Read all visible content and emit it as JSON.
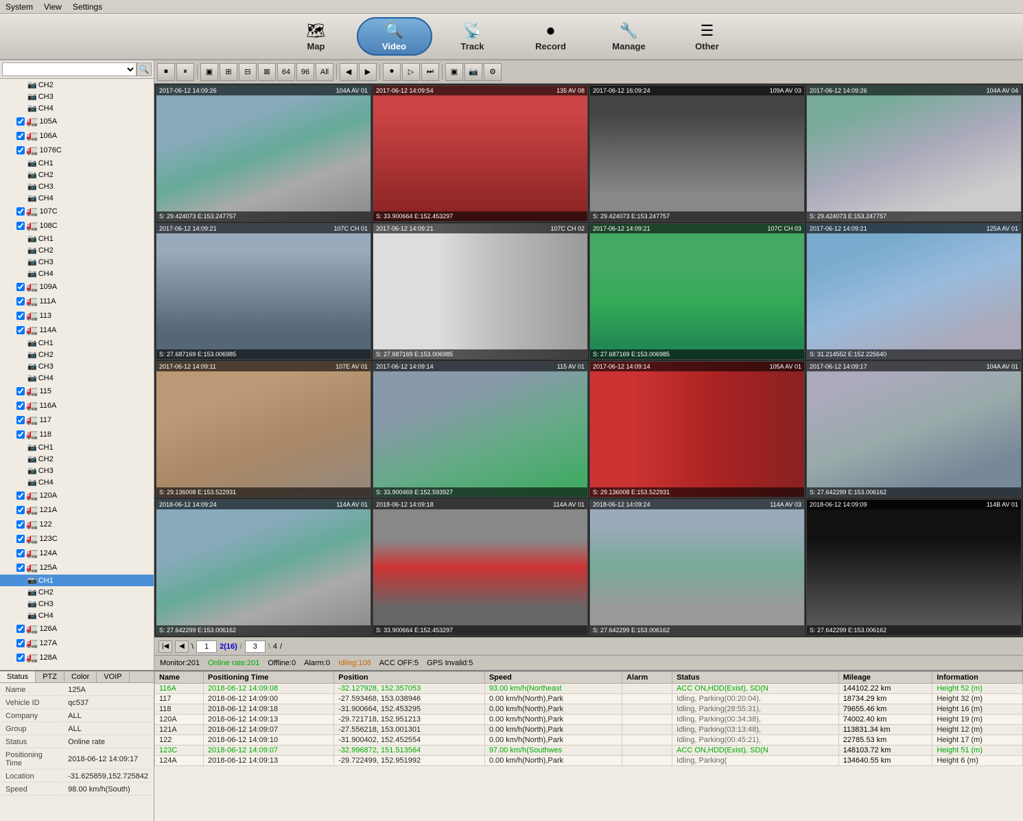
{
  "menubar": {
    "items": [
      "System",
      "View",
      "Settings"
    ]
  },
  "navbar": {
    "items": [
      {
        "label": "Map",
        "icon": "🗺",
        "active": false
      },
      {
        "label": "Video",
        "icon": "🔍",
        "active": true
      },
      {
        "label": "Track",
        "icon": "📡",
        "active": false
      },
      {
        "label": "Record",
        "icon": "⏺",
        "active": false
      },
      {
        "label": "Manage",
        "icon": "🔧",
        "active": false
      },
      {
        "label": "Other",
        "icon": "☰",
        "active": false
      }
    ]
  },
  "sidebar": {
    "tree": [
      {
        "label": "CH2",
        "indent": 3,
        "type": "camera"
      },
      {
        "label": "CH3",
        "indent": 3,
        "type": "camera"
      },
      {
        "label": "CH4",
        "indent": 3,
        "type": "camera"
      },
      {
        "label": "105A",
        "indent": 2,
        "type": "truck",
        "checked": true
      },
      {
        "label": "106A",
        "indent": 2,
        "type": "truck",
        "checked": true
      },
      {
        "label": "1076C",
        "indent": 2,
        "type": "truck",
        "checked": true
      },
      {
        "label": "CH1",
        "indent": 3,
        "type": "camera"
      },
      {
        "label": "CH2",
        "indent": 3,
        "type": "camera"
      },
      {
        "label": "CH3",
        "indent": 3,
        "type": "camera"
      },
      {
        "label": "CH4",
        "indent": 3,
        "type": "camera"
      },
      {
        "label": "107C",
        "indent": 2,
        "type": "truck",
        "checked": true
      },
      {
        "label": "108C",
        "indent": 2,
        "type": "truck",
        "checked": true
      },
      {
        "label": "CH1",
        "indent": 3,
        "type": "camera"
      },
      {
        "label": "CH2",
        "indent": 3,
        "type": "camera"
      },
      {
        "label": "CH3",
        "indent": 3,
        "type": "camera"
      },
      {
        "label": "CH4",
        "indent": 3,
        "type": "camera"
      },
      {
        "label": "109A",
        "indent": 2,
        "type": "truck",
        "checked": true
      },
      {
        "label": "111A",
        "indent": 2,
        "type": "truck",
        "checked": true
      },
      {
        "label": "113",
        "indent": 2,
        "type": "truck",
        "checked": true
      },
      {
        "label": "114A",
        "indent": 2,
        "type": "truck",
        "checked": true
      },
      {
        "label": "CH1",
        "indent": 3,
        "type": "camera"
      },
      {
        "label": "CH2",
        "indent": 3,
        "type": "camera"
      },
      {
        "label": "CH3",
        "indent": 3,
        "type": "camera"
      },
      {
        "label": "CH4",
        "indent": 3,
        "type": "camera"
      },
      {
        "label": "115",
        "indent": 2,
        "type": "truck",
        "checked": true
      },
      {
        "label": "116A",
        "indent": 2,
        "type": "truck",
        "checked": true
      },
      {
        "label": "117",
        "indent": 2,
        "type": "truck",
        "checked": true
      },
      {
        "label": "118",
        "indent": 2,
        "type": "truck",
        "checked": true
      },
      {
        "label": "CH1",
        "indent": 3,
        "type": "camera"
      },
      {
        "label": "CH2",
        "indent": 3,
        "type": "camera"
      },
      {
        "label": "CH3",
        "indent": 3,
        "type": "camera"
      },
      {
        "label": "CH4",
        "indent": 3,
        "type": "camera"
      },
      {
        "label": "120A",
        "indent": 2,
        "type": "truck",
        "checked": true
      },
      {
        "label": "121A",
        "indent": 2,
        "type": "truck",
        "checked": true
      },
      {
        "label": "122",
        "indent": 2,
        "type": "truck",
        "checked": true
      },
      {
        "label": "123C",
        "indent": 2,
        "type": "truck",
        "checked": true
      },
      {
        "label": "124A",
        "indent": 2,
        "type": "truck",
        "checked": true
      },
      {
        "label": "125A",
        "indent": 2,
        "type": "truck",
        "checked": true
      },
      {
        "label": "CH1",
        "indent": 3,
        "type": "camera",
        "selected": true
      },
      {
        "label": "CH2",
        "indent": 3,
        "type": "camera"
      },
      {
        "label": "CH3",
        "indent": 3,
        "type": "camera"
      },
      {
        "label": "CH4",
        "indent": 3,
        "type": "camera"
      },
      {
        "label": "126A",
        "indent": 2,
        "type": "truck",
        "checked": true
      },
      {
        "label": "127A",
        "indent": 2,
        "type": "truck",
        "checked": true
      },
      {
        "label": "128A",
        "indent": 2,
        "type": "truck",
        "checked": true
      }
    ]
  },
  "toolbar": {
    "buttons": [
      "⏹",
      "⏸",
      "⊞",
      "⊟",
      "⊠",
      "⊡",
      "⊢",
      "⊣",
      "64",
      "96",
      "All",
      "◀",
      "▶",
      "◉",
      "▷",
      "⏭",
      "▣",
      "📷",
      "🔧"
    ]
  },
  "videos": [
    {
      "id": "v1",
      "timestamp": "2017-06-12 14:09:26",
      "label": "104A AV 01",
      "coords": "S: 29.424073 E:153.247757",
      "style": "vc-road"
    },
    {
      "id": "v2",
      "timestamp": "2017-06-12 14:09:54",
      "label": "135 AV 08",
      "coords": "S: 33.900664 E:152.453297",
      "style": "vc-truck-back"
    },
    {
      "id": "v3",
      "timestamp": "2017-06-12 16:09:24",
      "label": "109A AV 03",
      "coords": "S: 29.424073 E:153.247757",
      "style": "vc-side"
    },
    {
      "id": "v4",
      "timestamp": "2017-06-12 14:09:26",
      "label": "104A AV 04",
      "coords": "S: 29.424073 E:153.247757",
      "style": "vc-highway"
    },
    {
      "id": "v5",
      "timestamp": "2017-06-12 14:09:21",
      "label": "107C CH 01",
      "coords": "S: 27.687169 E:153.006985",
      "style": "vc-intersection"
    },
    {
      "id": "v6",
      "timestamp": "2017-06-12 14:09:21",
      "label": "107C CH 02",
      "coords": "S: 27.687169 E:153.006985",
      "style": "vc-truck-side"
    },
    {
      "id": "v7",
      "timestamp": "2017-06-12 14:09:21",
      "label": "107C CH 03",
      "coords": "S: 27.687169 E:153.006985",
      "style": "vc-warehouse"
    },
    {
      "id": "v8",
      "timestamp": "2017-06-12 14:09:21",
      "label": "125A AV 01",
      "coords": "S: 31.214552 E:152.225640",
      "style": "vc-blue-sky"
    },
    {
      "id": "v9",
      "timestamp": "2017-06-12 14:09:11",
      "label": "107E AV 01",
      "coords": "S: 29.136008 E:153.522931",
      "style": "vc-dirt-road"
    },
    {
      "id": "v10",
      "timestamp": "2017-06-12 14:09:14",
      "label": "115 AV 01",
      "coords": "S: 33.900469 E:152.593927",
      "style": "vc-suburban"
    },
    {
      "id": "v11",
      "timestamp": "2017-06-12 14:09:14",
      "label": "105A AV 01",
      "coords": "S: 29.136008 E:153.522931",
      "style": "vc-red-truck"
    },
    {
      "id": "v12",
      "timestamp": "2017-06-12 14:09:17",
      "label": "104A AV 01",
      "coords": "S: 27.642299 E:153.006162",
      "style": "vc-highway2"
    },
    {
      "id": "v13",
      "timestamp": "2018-06-12 14:09:24",
      "label": "114A AV 01",
      "coords": "S: 27.642299 E:153.006162",
      "style": "vc-road"
    },
    {
      "id": "v14",
      "timestamp": "2018-06-12 14:09:18",
      "label": "114A AV 01",
      "coords": "S: 33.900664 E:152.453297",
      "style": "vc-red-car"
    },
    {
      "id": "v15",
      "timestamp": "2018-06-12 14:09:24",
      "label": "114A AV 03",
      "coords": "S: 27.642299 E:153.006162",
      "style": "vc-car-park"
    },
    {
      "id": "v16",
      "timestamp": "2018-06-12 14:09:09",
      "label": "114B AV 01",
      "coords": "S: 27.642299 E:153.006162",
      "style": "vc-night"
    }
  ],
  "pagination": {
    "prev_label": "◀",
    "next_label": "▶",
    "page_display": "2(16)",
    "total_pages": "4",
    "current_input": "3"
  },
  "statusbar": {
    "monitor": "Monitor:201",
    "online": "Online rate:201",
    "offline": "Offline:0",
    "alarm": "Alarm:0",
    "idling": "Idling:108",
    "acc_off": "ACC OFF:5",
    "gps_invalid": "GPS Invalid:5"
  },
  "bottom_tabs": [
    "Status",
    "PTZ",
    "Color",
    "VOIP"
  ],
  "vehicle_info": {
    "name_label": "Name",
    "name_value": "125A",
    "vehicle_id_label": "Vehicle ID",
    "vehicle_id_value": "qc537",
    "company_label": "Company",
    "company_value": "ALL",
    "group_label": "Group",
    "group_value": "ALL",
    "status_label": "Status",
    "status_value": "Online rate",
    "pos_time_label": "Positioning Time",
    "pos_time_value": "2018-06-12 14:09:17",
    "location_label": "Location",
    "location_value": "-31.625859,152.725842",
    "speed_label": "Speed",
    "speed_value": "98.00 km/h(South)"
  },
  "table": {
    "headers": [
      "Name",
      "Positioning Time",
      "Position",
      "Speed",
      "Alarm",
      "Status",
      "Mileage",
      "Information"
    ],
    "rows": [
      {
        "name": "116A",
        "pos_time": "2018-06-12 14:09:08",
        "position": "-32.127928, 152.357053",
        "speed": "93.00 km/h(Northeast",
        "alarm": "",
        "status": "ACC ON,HDD(Exist), SD(N",
        "mileage": "144102.22 km",
        "info": "Height 52 (m)",
        "highlight": true
      },
      {
        "name": "117",
        "pos_time": "2018-06-12 14:09:00",
        "position": "-27.593468, 153.038946",
        "speed": "0.00 km/h(North),Park",
        "alarm": "",
        "status": "Idling, Parking(00:20:04),",
        "mileage": "18734.29 km",
        "info": "Height 32 (m)",
        "highlight": false
      },
      {
        "name": "118",
        "pos_time": "2018-06-12 14:09:18",
        "position": "-31.900664, 152.453295",
        "speed": "0.00 km/h(North),Park",
        "alarm": "",
        "status": "Idling, Parking(28:55:31),",
        "mileage": "79655.46 km",
        "info": "Height 16 (m)",
        "highlight": false
      },
      {
        "name": "120A",
        "pos_time": "2018-06-12 14:09:13",
        "position": "-29.721718, 152.951213",
        "speed": "0.00 km/h(North),Park",
        "alarm": "",
        "status": "Idling, Parking(00:34:38),",
        "mileage": "74002.40 km",
        "info": "Height 19 (m)",
        "highlight": false
      },
      {
        "name": "121A",
        "pos_time": "2018-06-12 14:09:07",
        "position": "-27.556218, 153.001301",
        "speed": "0.00 km/h(North),Park",
        "alarm": "",
        "status": "Idling, Parking(03:13:48),",
        "mileage": "113831.34 km",
        "info": "Height 12 (m)",
        "highlight": false
      },
      {
        "name": "122",
        "pos_time": "2018-06-12 14:09:10",
        "position": "-31.900402, 152.452554",
        "speed": "0.00 km/h(North),Park",
        "alarm": "",
        "status": "Idling, Parking(00:45:21),",
        "mileage": "22785.53 km",
        "info": "Height 17 (m)",
        "highlight": false
      },
      {
        "name": "123C",
        "pos_time": "2018-06-12 14:09:07",
        "position": "-32.996872, 151.513564",
        "speed": "97.00 km/h(Southwes",
        "alarm": "",
        "status": "ACC ON,HDD(Exist), SD(N",
        "mileage": "148103.72 km",
        "info": "Height 51 (m)",
        "highlight": true
      },
      {
        "name": "124A",
        "pos_time": "2018-06-12 14:09:13",
        "position": "-29.722499, 152.951992",
        "speed": "0.00 km/h(North),Park",
        "alarm": "",
        "status": "Idling, Parking(",
        "mileage": "134640.55 km",
        "info": "Height 6 (m)",
        "highlight": false
      }
    ]
  },
  "colors": {
    "accent_blue": "#4a90d8",
    "green_text": "#00aa00",
    "orange_text": "#cc6600",
    "highlight_green": "#00cc00"
  }
}
